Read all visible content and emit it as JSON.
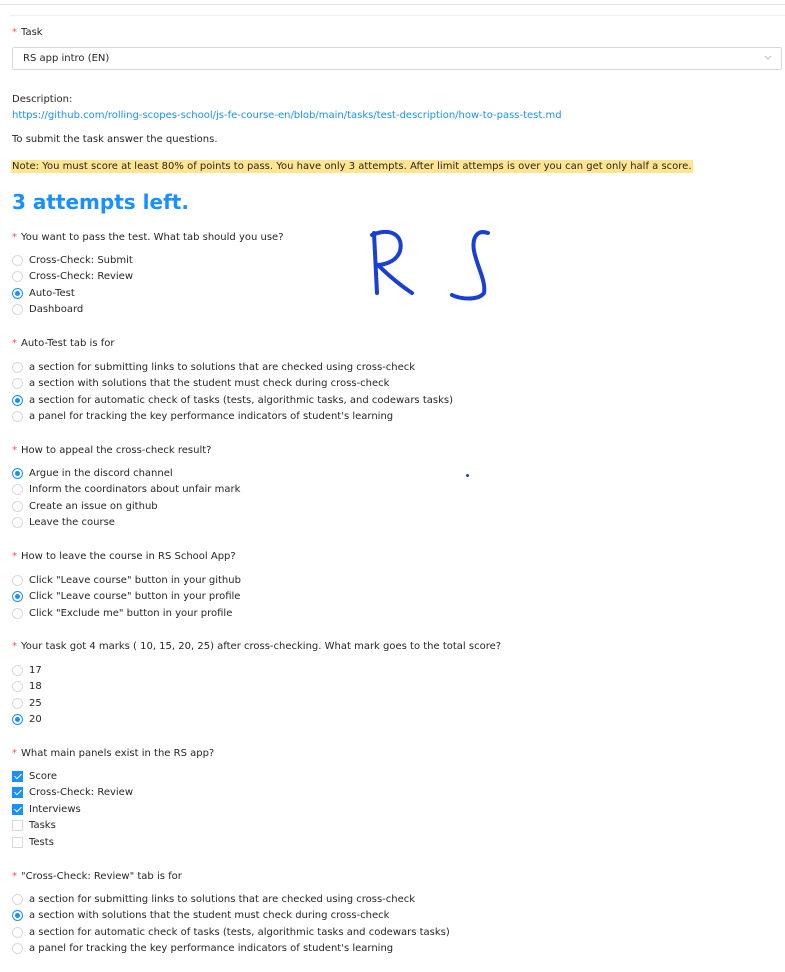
{
  "task": {
    "label": "Task",
    "selected": "RS app intro (EN)"
  },
  "description": {
    "label": "Description:",
    "link": "https://github.com/rolling-scopes-school/js-fe-course-en/blob/main/tasks/test-description/how-to-pass-test.md"
  },
  "instruction": "To submit the task answer the questions.",
  "note": "Note: You must score at least 80% of points to pass. You have only 3 attempts. After limit attemps is over you can get only half a score.",
  "attempts_left": "3 attempts left.",
  "handwriting": "R S",
  "questions": [
    {
      "text": "You want to pass the test. What tab should you use?",
      "type": "radio",
      "options": [
        {
          "label": "Cross-Check: Submit",
          "checked": false
        },
        {
          "label": "Cross-Check: Review",
          "checked": false
        },
        {
          "label": "Auto-Test",
          "checked": true
        },
        {
          "label": "Dashboard",
          "checked": false
        }
      ]
    },
    {
      "text": "Auto-Test tab is for",
      "type": "radio",
      "options": [
        {
          "label": "a section for submitting links to solutions that are checked using cross-check",
          "checked": false
        },
        {
          "label": "a section with solutions that the student must check during cross-check",
          "checked": false
        },
        {
          "label": "a section for automatic check of tasks (tests, algorithmic tasks, and codewars tasks)",
          "checked": true
        },
        {
          "label": "a panel for tracking the key performance indicators of student's learning",
          "checked": false
        }
      ]
    },
    {
      "text": "How to appeal the cross-check result?",
      "type": "radio",
      "options": [
        {
          "label": "Argue in the discord channel",
          "checked": true
        },
        {
          "label": "Inform the coordinators about unfair mark",
          "checked": false
        },
        {
          "label": "Create an issue on github",
          "checked": false
        },
        {
          "label": "Leave the course",
          "checked": false
        }
      ]
    },
    {
      "text": "How to leave the course in RS School App?",
      "type": "radio",
      "options": [
        {
          "label": "Click \"Leave course\" button in your github",
          "checked": false
        },
        {
          "label": "Click \"Leave course\" button in your profile",
          "checked": true
        },
        {
          "label": "Click \"Exclude me\" button in your profile",
          "checked": false
        }
      ]
    },
    {
      "text": "Your task got 4 marks ( 10, 15, 20, 25) after cross-checking. What mark goes to the total score?",
      "type": "radio",
      "options": [
        {
          "label": "17",
          "checked": false
        },
        {
          "label": "18",
          "checked": false
        },
        {
          "label": "25",
          "checked": false
        },
        {
          "label": "20",
          "checked": true
        }
      ]
    },
    {
      "text": "What main panels exist in the RS app?",
      "type": "checkbox",
      "options": [
        {
          "label": "Score",
          "checked": true
        },
        {
          "label": "Cross-Check: Review",
          "checked": true
        },
        {
          "label": "Interviews",
          "checked": true
        },
        {
          "label": "Tasks",
          "checked": false
        },
        {
          "label": "Tests",
          "checked": false
        }
      ]
    },
    {
      "text": "\"Cross-Check: Review\" tab is for",
      "type": "radio",
      "options": [
        {
          "label": "a section for submitting links to solutions that are checked using cross-check",
          "checked": false
        },
        {
          "label": "a section with solutions that the student must check during cross-check",
          "checked": true
        },
        {
          "label": "a section for automatic check of tasks (tests, algorithmic tasks and codewars tasks)",
          "checked": false
        },
        {
          "label": "a panel for tracking the key performance indicators of student's learning",
          "checked": false
        }
      ]
    }
  ],
  "colors": {
    "accent": "#1890ff",
    "required": "#ff4d4f",
    "note_bg": "#ffe58f",
    "ink": "#1a3fd4"
  }
}
